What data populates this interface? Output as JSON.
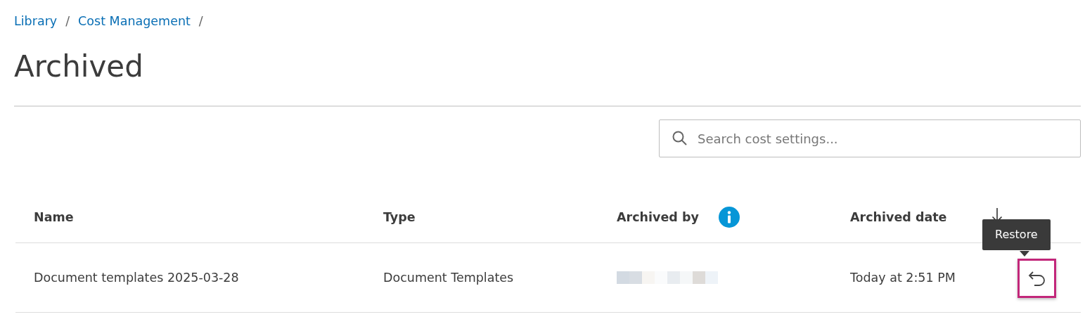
{
  "breadcrumb": {
    "separator": "/",
    "items": [
      {
        "label": "Library"
      },
      {
        "label": "Cost Management"
      }
    ]
  },
  "title": "Archived",
  "search": {
    "placeholder": "Search cost settings..."
  },
  "table": {
    "columns": [
      {
        "label": "Name",
        "info": false,
        "sorted": false
      },
      {
        "label": "Type",
        "info": false,
        "sorted": false
      },
      {
        "label": "Archived by",
        "info": true,
        "sorted": false
      },
      {
        "label": "Archived date",
        "info": false,
        "sorted": true
      }
    ],
    "rows": [
      {
        "name": "Document templates 2025-03-28",
        "type": "Document Templates",
        "archived_date": "Today at 2:51 PM",
        "restore_focused": true
      }
    ]
  },
  "tooltip": {
    "text": "Restore"
  }
}
